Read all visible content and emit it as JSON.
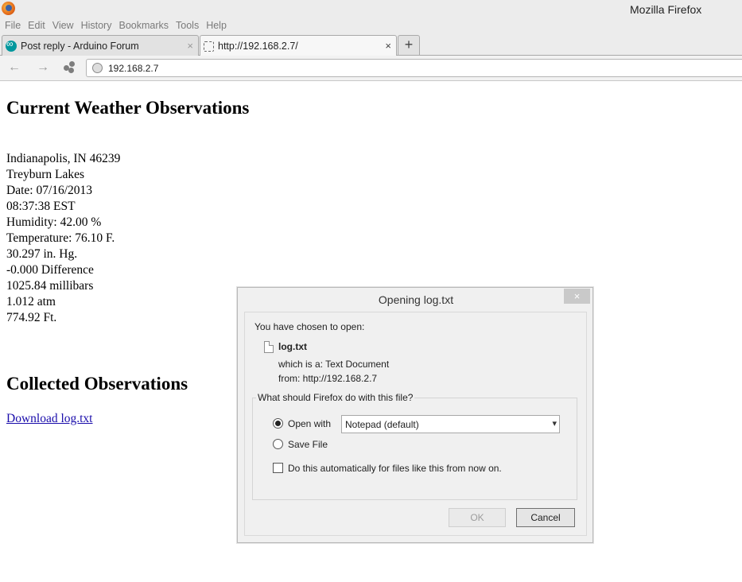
{
  "window": {
    "title": "Mozilla Firefox"
  },
  "menu": [
    {
      "label": "File"
    },
    {
      "label": "Edit"
    },
    {
      "label": "View"
    },
    {
      "label": "History"
    },
    {
      "label": "Bookmarks"
    },
    {
      "label": "Tools"
    },
    {
      "label": "Help"
    }
  ],
  "tabs": [
    {
      "label": "Post reply - Arduino Forum",
      "close": "×",
      "favicon": "arduino-icon"
    },
    {
      "label": "http://192.168.2.7/",
      "close": "×",
      "favicon": "blank-page-icon"
    }
  ],
  "newtab": {
    "label": "+"
  },
  "nav": {
    "back": "←",
    "forward": "→",
    "url": "192.168.2.7"
  },
  "page": {
    "heading1": "Current Weather Observations",
    "observations": [
      "Indianapolis, IN 46239",
      "Treyburn Lakes",
      "Date: 07/16/2013",
      "08:37:38 EST",
      "Humidity: 42.00 %",
      "Temperature: 76.10 F.",
      "30.297 in. Hg.",
      "-0.000 Difference",
      "1025.84 millibars",
      "1.012 atm",
      "774.92 Ft."
    ],
    "heading2": "Collected Observations",
    "download_link": "Download log.txt"
  },
  "dialog": {
    "title": "Opening log.txt",
    "close": "×",
    "chosen": "You have chosen to open:",
    "filename": "log.txt",
    "which_is": "which is a:  Text Document",
    "from": "from:  http://192.168.2.7",
    "question": "What should Firefox do with this file?",
    "open_with": {
      "label": "Open with",
      "checked": true
    },
    "app_select": "Notepad (default)",
    "save_file": {
      "label": "Save File",
      "checked": false
    },
    "auto": {
      "label": "Do this automatically for files like this from now on.",
      "checked": false
    },
    "ok": "OK",
    "cancel": "Cancel"
  }
}
